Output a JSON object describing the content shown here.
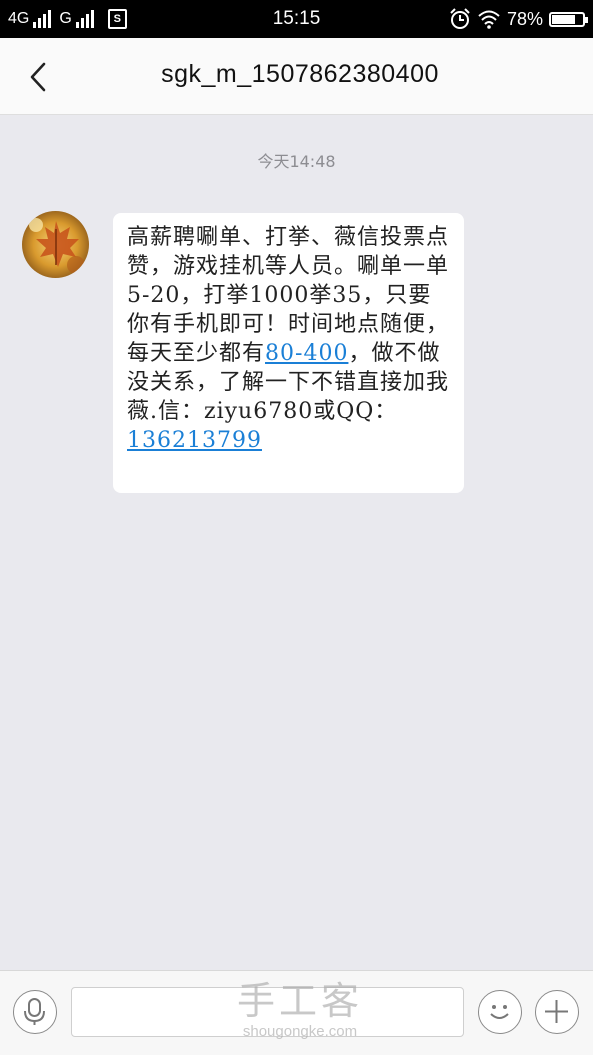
{
  "status_bar": {
    "network_1": "4G",
    "network_2": "G",
    "sim_badge": "S",
    "time": "15:15",
    "battery_percent": "78%",
    "battery_level": 0.78,
    "icons": [
      "signal-icon",
      "sim-card-icon",
      "alarm-icon",
      "wifi-icon",
      "battery-icon"
    ]
  },
  "header": {
    "title": "sgk_m_1507862380400",
    "back_icon": "chevron-left-icon"
  },
  "conversation": {
    "timestamp": "今天14:48",
    "message": {
      "text_1": "高薪聘唰单、打挙、薇信投票点赞，游戏挂机等人员。唰单一单5-20，打挙1000挙35，只要你有手机即可！时间地点随便，每天至少都有",
      "link_1": "80-400",
      "text_2": "，做不做没关系，了解一下不错直接加我薇.信：ziyu6780或QQ：",
      "link_2": "136213799"
    }
  },
  "input_bar": {
    "voice_icon": "microphone-icon",
    "emoji_icon": "smiley-icon",
    "add_icon": "plus-icon",
    "watermark_title": "手工客",
    "watermark_url": "shougongke.com"
  },
  "colors": {
    "link": "#1a7fd6",
    "background": "#e9e9ee",
    "bubble": "#ffffff"
  }
}
